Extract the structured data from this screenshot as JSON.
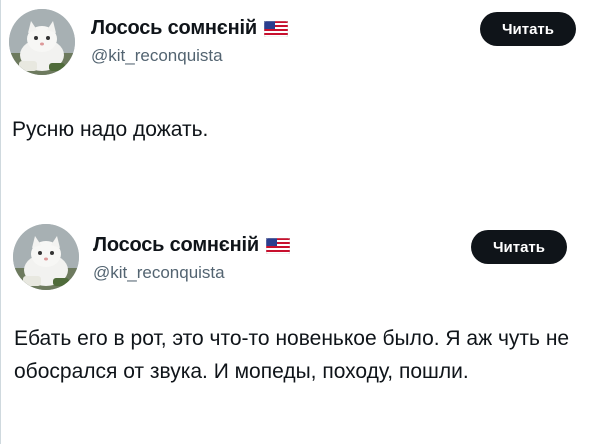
{
  "tweets": [
    {
      "display_name": "Лосось сомнєній",
      "handle": "@kit_reconquista",
      "follow_label": "Читать",
      "badge_icon": "us-flag-icon",
      "avatar": "white-cat-avatar",
      "text": "Русню надо дожать."
    },
    {
      "display_name": "Лосось сомнєній",
      "handle": "@kit_reconquista",
      "follow_label": "Читать",
      "badge_icon": "us-flag-icon",
      "avatar": "white-cat-avatar",
      "text": "Ебать его в рот, это что-то новенькое было. Я аж чуть не обосрался от звука. И мопеды, походу, пошли."
    }
  ],
  "colors": {
    "text": "#0f1419",
    "secondary_text": "#536471",
    "button_bg": "#0f1419",
    "button_text": "#ffffff"
  }
}
